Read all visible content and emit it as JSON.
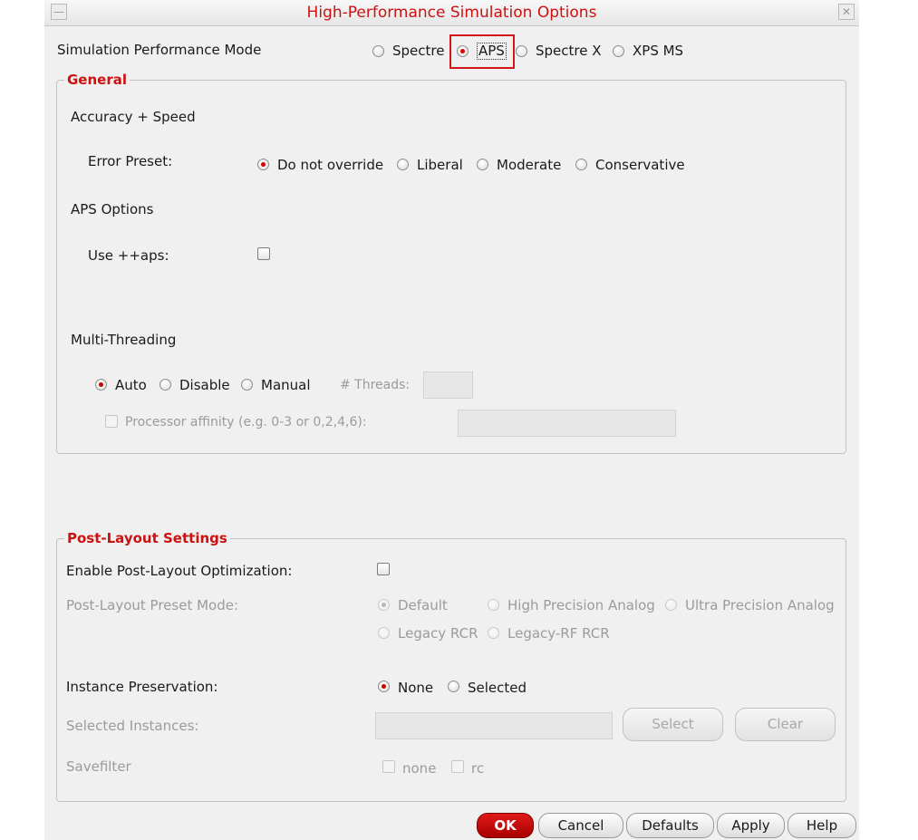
{
  "window": {
    "title": "High-Performance Simulation Options"
  },
  "mode": {
    "label": "Simulation Performance Mode",
    "options": [
      "Spectre",
      "APS",
      "Spectre X",
      "XPS MS"
    ],
    "selected": "APS"
  },
  "general": {
    "legend": "General",
    "accuracy": {
      "heading": "Accuracy + Speed",
      "error_preset_label": "Error Preset:",
      "options": [
        "Do not override",
        "Liberal",
        "Moderate",
        "Conservative"
      ],
      "selected": "Do not override"
    },
    "aps_options": {
      "heading": "APS Options",
      "use_aps_label": "Use ++aps:",
      "use_aps_checked": false
    },
    "multithreading": {
      "heading": "Multi-Threading",
      "options": [
        "Auto",
        "Disable",
        "Manual"
      ],
      "selected": "Auto",
      "threads_label": "# Threads:",
      "threads_value": "",
      "affinity_label": "Processor affinity (e.g. 0-3 or 0,2,4,6):",
      "affinity_value": "",
      "affinity_checked": false
    }
  },
  "post_layout": {
    "legend": "Post-Layout Settings",
    "enable_label": "Enable Post-Layout Optimization:",
    "enable_checked": false,
    "preset_label": "Post-Layout Preset Mode:",
    "preset_options": [
      "Default",
      "High Precision Analog",
      "Ultra Precision Analog",
      "Legacy RCR",
      "Legacy-RF RCR"
    ],
    "preset_selected": "Default",
    "instance_label": "Instance Preservation:",
    "instance_options": [
      "None",
      "Selected"
    ],
    "instance_selected": "None",
    "selected_instances_label": "Selected Instances:",
    "selected_instances_value": "",
    "select_button": "Select",
    "clear_button": "Clear",
    "savefilter_label": "Savefilter",
    "savefilter_options": [
      "none",
      "rc"
    ]
  },
  "buttons": {
    "ok": "OK",
    "cancel": "Cancel",
    "defaults": "Defaults",
    "apply": "Apply",
    "help": "Help"
  },
  "colors": {
    "accent": "#cc1111",
    "highlight_box": "#d4151b",
    "ok_button": "#c00000"
  }
}
